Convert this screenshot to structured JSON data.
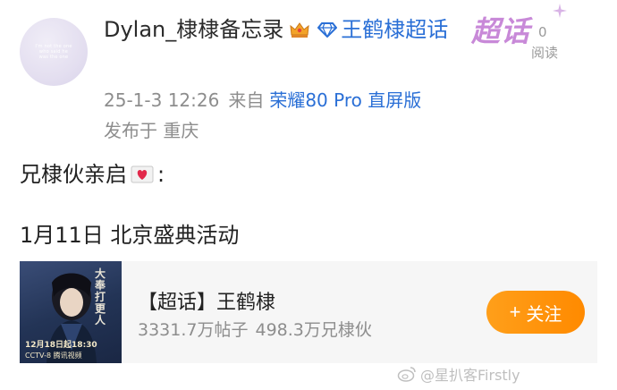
{
  "avatar": {
    "text": "I'm not the one who said he was the one"
  },
  "post": {
    "user_name": "Dylan_棣棣备忘录",
    "topic": "王鹤棣超话",
    "time": "25-1-3 12:26",
    "from_label": "来自",
    "device": "荣耀80 Pro 直屏版",
    "location": "发布于 重庆",
    "text_line1_before": "兄棣伙亲启",
    "text_line1_after": ":",
    "text_line2": "1月11日  北京盛典活动"
  },
  "chaohua": {
    "mark": "超话",
    "read_count": "0",
    "read_label": "阅读"
  },
  "card": {
    "title": "【超话】王鹤棣",
    "posts": "3331.7万帖子",
    "fans": "498.3万兄棣伙",
    "follow_label": "关注",
    "poster": {
      "title": "大奉打更人",
      "date": "12月18日起18:30",
      "channel": "CCTV-8 腾讯视频"
    }
  },
  "watermark": {
    "text": "@星扒客Firstly"
  },
  "colors": {
    "link": "#2a6fd6",
    "accent": "#ff8a00",
    "chaohua": "#c889d8"
  },
  "icons": [
    "crown-icon",
    "diamond-icon",
    "heart-icon",
    "sparkle-icon",
    "weibo-icon"
  ]
}
